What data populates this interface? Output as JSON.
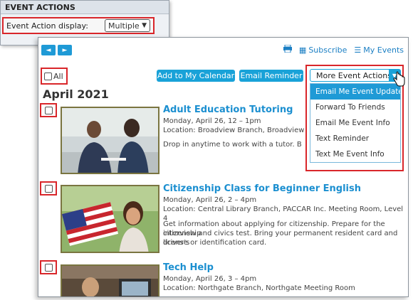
{
  "settings": {
    "header": "EVENT ACTIONS",
    "display_label": "Event Action display:",
    "display_value": "Multiple"
  },
  "toolbar": {
    "prev_icon": "◄",
    "next_icon": "►",
    "print_icon": "print-icon",
    "subscribe": "Subscribe",
    "my_events": "My Events"
  },
  "select_all": "All",
  "buttons": {
    "add_calendar": "Add to My Calendar",
    "email_reminder": "Email Reminder",
    "more_actions": "More Event Actions"
  },
  "menu_items": [
    "Email Me Event Updates",
    "Forward To Friends",
    "Email Me Event Info",
    "Text Reminder",
    "Text Me Event Info"
  ],
  "month": "April 2021",
  "events": [
    {
      "title": "Adult Education Tutoring",
      "time": "Monday, April 26, 12 – 1pm",
      "location": "Location: Broadview Branch, Broadview Meeti",
      "description": "Drop in anytime to work with a tutor. Books a"
    },
    {
      "title": "Citizenship Class for Beginner English",
      "time": "Monday, April 26, 2 – 4pm",
      "location": "Location: Central Library Branch, PACCAR Inc. Meeting Room, Level 4",
      "description_1": "Get information about applying for citizenship. Prepare for the citizenship",
      "description_2": "interview and civics test. Bring your permanent resident card and driver's",
      "description_3": "license or identification card."
    },
    {
      "title": "Tech Help",
      "time": "Monday, April 26, 3 – 4pm",
      "location": "Location: Northgate Branch, Northgate Meeting Room"
    }
  ]
}
